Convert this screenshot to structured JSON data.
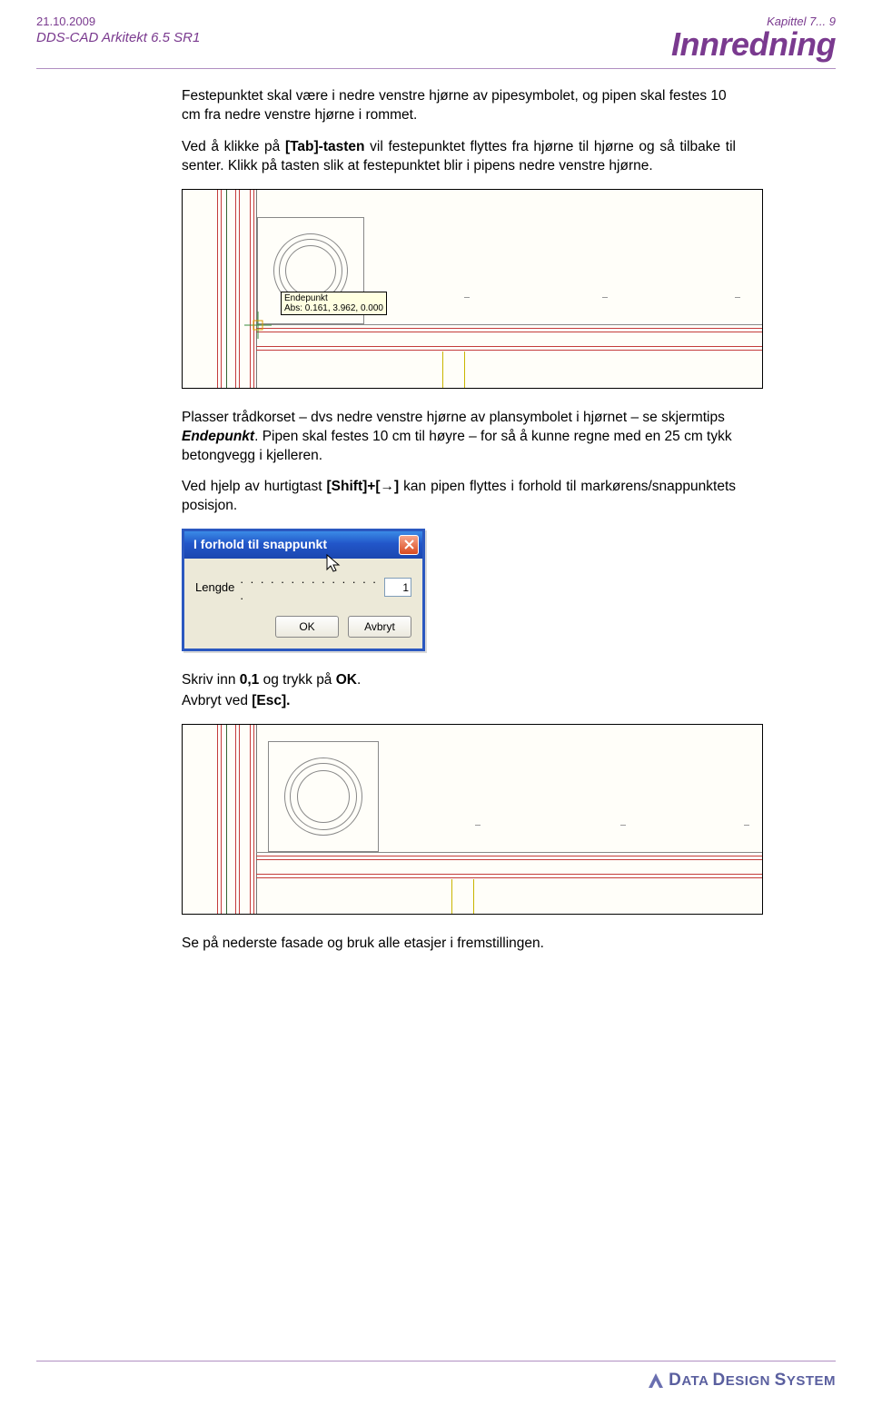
{
  "header": {
    "date": "21.10.2009",
    "product": "DDS-CAD Arkitekt  6.5 SR1",
    "chapter": "Kapittel 7...",
    "page_number": "9",
    "title": "Innredning"
  },
  "body": {
    "p1": "Festepunktet skal være i nedre venstre hjørne av pipesymbolet, og pipen skal festes 10 cm fra nedre venstre hjørne i rommet.",
    "p2a": "Ved å klikke på ",
    "p2b": "[Tab]-tasten",
    "p2c": " vil festepunktet flyttes fra hjørne til hjørne og så tilbake til senter. Klikk på tasten slik at festepunktet blir i pipens nedre venstre hjørne.",
    "cad1_tooltip_line1": "Endepunkt",
    "cad1_tooltip_line2": "Abs: 0.161, 3.962, 0.000",
    "p3a": "Plasser trådkorset – dvs nedre venstre hjørne av plansymbolet i hjørnet – se skjermtips ",
    "p3b": "Endepunkt",
    "p3c": ". Pipen skal festes 10 cm til høyre – for så å kunne regne med en 25 cm tykk betongvegg i kjelleren.",
    "p4a": "Ved hjelp av hurtigtast ",
    "p4b": "[Shift]+[→]",
    "p4c": " kan pipen flyttes i forhold til markørens/snappunktets posisjon.",
    "p5a": "Skriv inn ",
    "p5b": "0,1",
    "p5c": " og trykk på ",
    "p5d": "OK",
    "p5e": ".",
    "p6a": "Avbryt ved ",
    "p6b": "[Esc].",
    "p7": "Se på nederste fasade og bruk alle etasjer i fremstillingen."
  },
  "dialog": {
    "title": "I forhold til snappunkt",
    "label": "Lengde",
    "dots": ". . . . . . . . . . . . . . .",
    "value": "1",
    "ok": "OK",
    "cancel": "Avbryt"
  },
  "footer": {
    "brand": "DATA DESIGN SYSTEM"
  }
}
